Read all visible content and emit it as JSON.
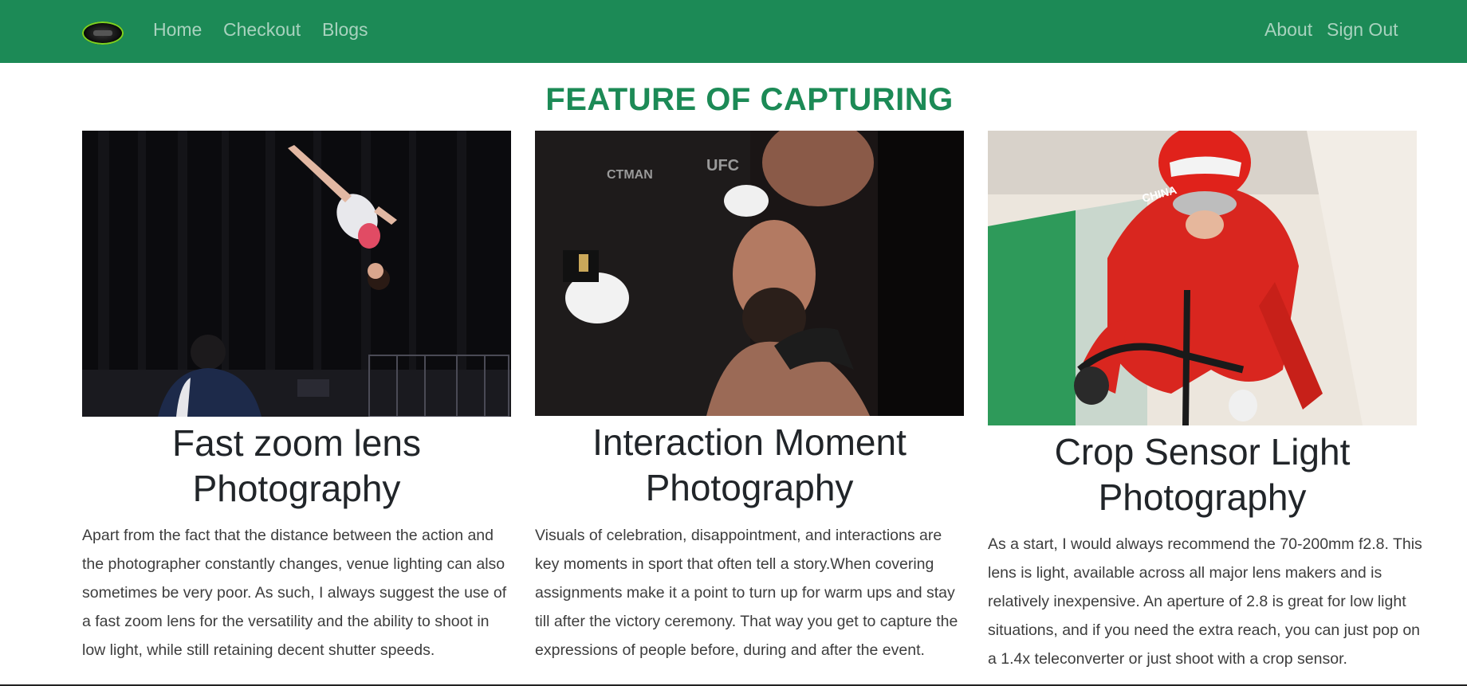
{
  "navbar": {
    "logo_icon": "camera-lens-logo-icon",
    "links": [
      "Home",
      "Checkout",
      "Blogs"
    ],
    "right_links": [
      "About",
      "Sign Out"
    ],
    "background": "#1c8a56"
  },
  "main": {
    "title": "FEATURE OF CAPTURING",
    "title_color": "#1c8a56",
    "cards": [
      {
        "image": "gymnast-somersault-photo",
        "heading": "Fast zoom lens Photography",
        "text": "Apart from the fact that the distance between the action and the photographer constantly changes, venue lighting can also sometimes be very poor. As such, I always suggest the use of a fast zoom lens for the versatility and the ability to shoot in low light, while still retaining decent shutter speeds."
      },
      {
        "image": "fighter-cutman-photo",
        "heading": "Interaction Moment Photography",
        "text": "Visuals of celebration, disappointment, and interactions are key moments in sport that often tell a story.When covering assignments make it a point to turn up for warm ups and stay till after the victory ceremony. That way you get to capture the expressions of people before, during and after the event."
      },
      {
        "image": "track-cyclist-photo",
        "heading": "Crop Sensor Light Photography",
        "text": "As a start, I would always recommend the 70-200mm f2.8. This lens is light, available across all major lens makers and is relatively inexpensive. An aperture of 2.8 is great for low light situations, and if you need the extra reach, you can just pop on a 1.4x teleconverter or just shoot with a crop sensor."
      }
    ]
  }
}
